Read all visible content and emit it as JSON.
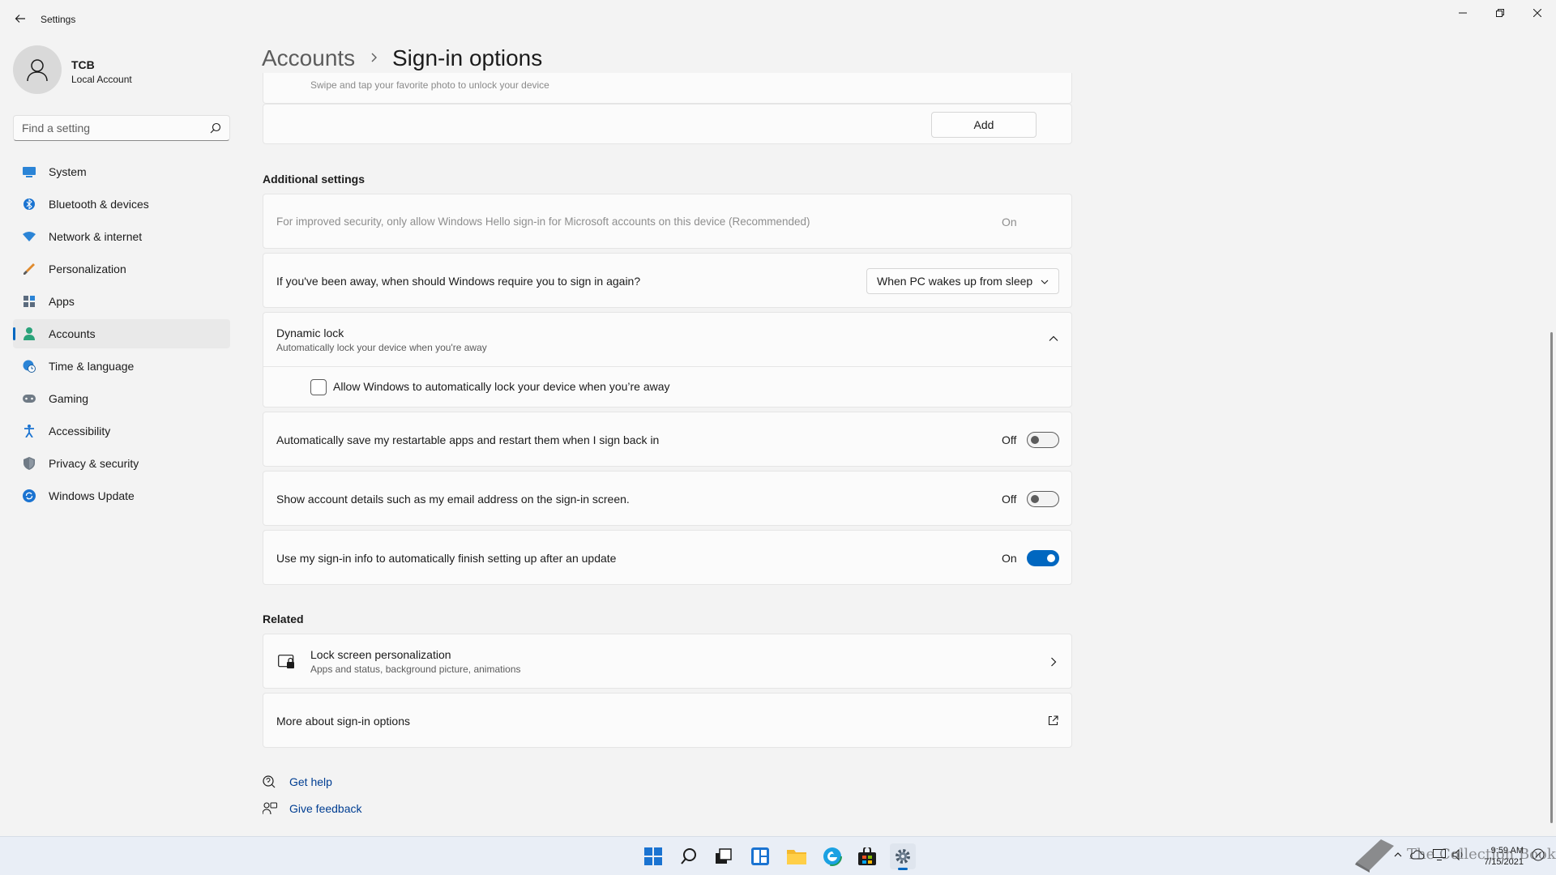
{
  "window": {
    "title": "Settings"
  },
  "profile": {
    "name": "TCB",
    "account_type": "Local Account"
  },
  "search": {
    "placeholder": "Find a setting"
  },
  "nav": {
    "items": [
      {
        "label": "System",
        "icon": "monitor-icon"
      },
      {
        "label": "Bluetooth & devices",
        "icon": "bluetooth-icon"
      },
      {
        "label": "Network & internet",
        "icon": "wifi-icon"
      },
      {
        "label": "Personalization",
        "icon": "brush-icon"
      },
      {
        "label": "Apps",
        "icon": "apps-icon"
      },
      {
        "label": "Accounts",
        "icon": "person-icon",
        "active": true
      },
      {
        "label": "Time & language",
        "icon": "globe-clock-icon"
      },
      {
        "label": "Gaming",
        "icon": "gamepad-icon"
      },
      {
        "label": "Accessibility",
        "icon": "accessibility-icon"
      },
      {
        "label": "Privacy & security",
        "icon": "shield-icon"
      },
      {
        "label": "Windows Update",
        "icon": "update-icon"
      }
    ]
  },
  "header": {
    "breadcrumb": "Accounts",
    "title": "Sign-in options"
  },
  "picture_password": {
    "partial_description": "Swipe and tap your favorite photo to unlock your device",
    "add_label": "Add"
  },
  "additional": {
    "heading": "Additional settings",
    "hello_only": {
      "label": "For improved security, only allow Windows Hello sign-in for Microsoft accounts on this device (Recommended)",
      "state": "On"
    },
    "require_signin": {
      "label": "If you've been away, when should Windows require you to sign in again?",
      "selected": "When PC wakes up from sleep"
    },
    "dynamic_lock": {
      "title": "Dynamic lock",
      "subtitle": "Automatically lock your device when you're away",
      "checkbox_label": "Allow Windows to automatically lock your device when you’re away",
      "checked": false
    },
    "restart_apps": {
      "label": "Automatically save my restartable apps and restart them when I sign back in",
      "state": "Off",
      "on": false
    },
    "account_details": {
      "label": "Show account details such as my email address on the sign-in screen.",
      "state": "Off",
      "on": false
    },
    "signin_info": {
      "label": "Use my sign-in info to automatically finish setting up after an update",
      "state": "On",
      "on": true
    }
  },
  "related": {
    "heading": "Related",
    "lock_screen": {
      "title": "Lock screen personalization",
      "subtitle": "Apps and status, background picture, animations"
    },
    "more": {
      "label": "More about sign-in options"
    }
  },
  "help": {
    "get_help": "Get help",
    "give_feedback": "Give feedback"
  },
  "taskbar": {
    "time": "9:59 AM",
    "date": "7/15/2021",
    "watermark": "The Collection Book"
  },
  "colors": {
    "accent": "#0067c0",
    "background": "#f3f3f3",
    "card": "#fbfbfb"
  }
}
